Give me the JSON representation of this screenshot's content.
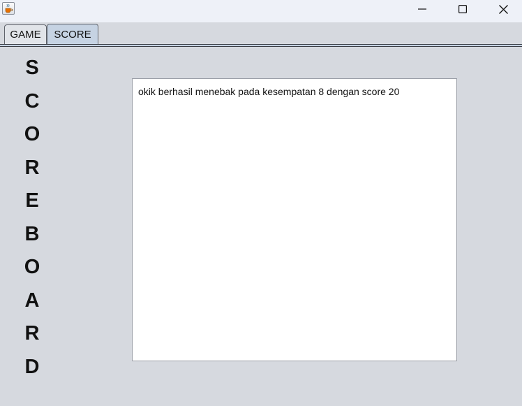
{
  "window": {
    "icon": "java-cup-icon",
    "controls": [
      "minimize-icon",
      "maximize-icon",
      "close-icon"
    ]
  },
  "tabs": [
    {
      "label": "GAME",
      "selected": false
    },
    {
      "label": "SCORE",
      "selected": true
    }
  ],
  "scoreboard": {
    "title_letters": [
      "S",
      "C",
      "O",
      "R",
      "E",
      "B",
      "O",
      "A",
      "R",
      "D"
    ],
    "log_text": "okik berhasil menebak pada kesempatan 8 dengan score 20"
  },
  "colors": {
    "background": "#d6d9df",
    "selected_tab": "#c6d3e3",
    "text_area": "#ffffff"
  }
}
